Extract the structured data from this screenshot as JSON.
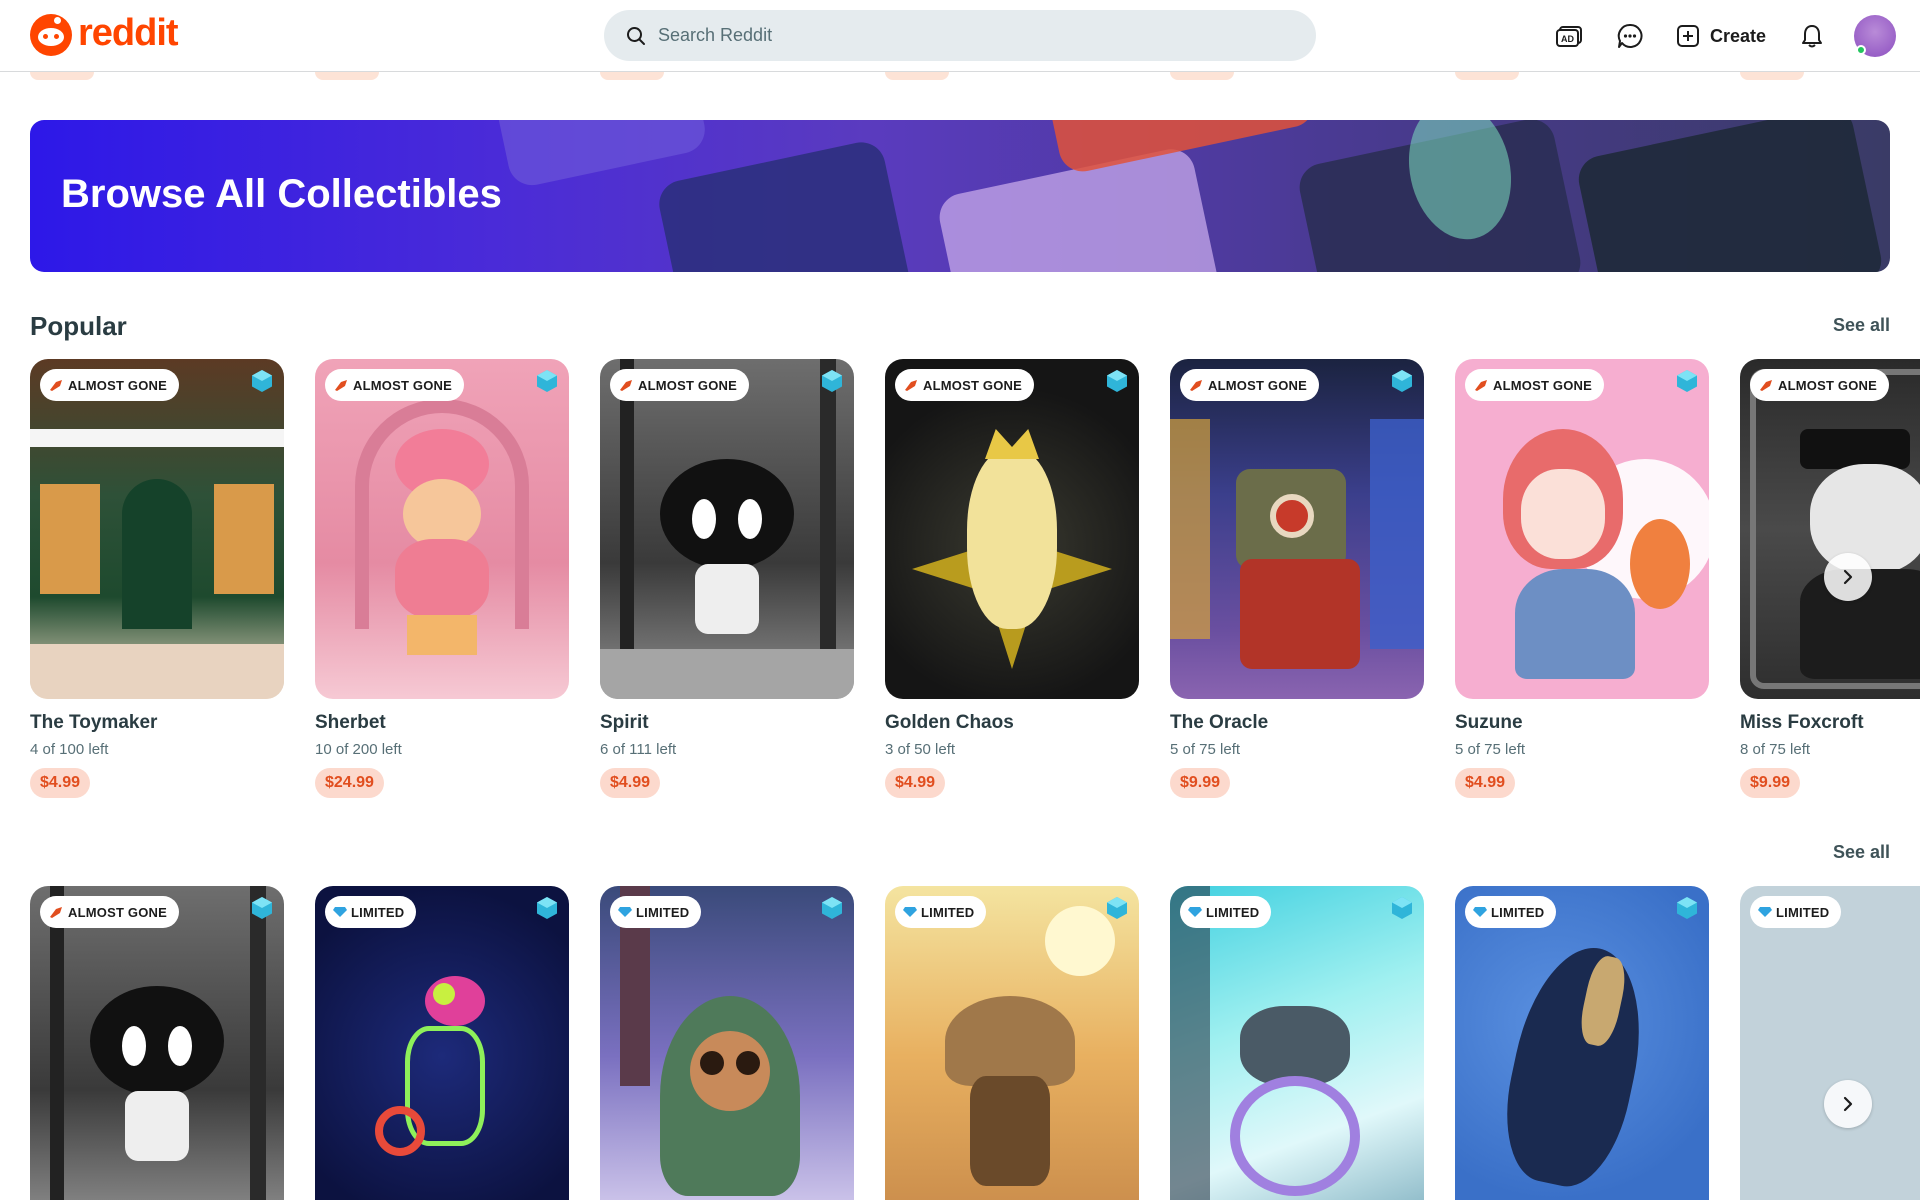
{
  "header": {
    "logo_text": "reddit",
    "search_placeholder": "Search Reddit",
    "create_label": "Create",
    "icons": [
      "advertise-icon",
      "chat-icon",
      "create-plus-icon",
      "notifications-bell-icon",
      "user-avatar"
    ]
  },
  "banner": {
    "title": "Browse All Collectibles"
  },
  "popular": {
    "title": "Popular",
    "see_all": "See all",
    "items": [
      {
        "badge": "ALMOST GONE",
        "name": "The Toymaker",
        "left": "4 of 100 left",
        "price": "$4.99"
      },
      {
        "badge": "ALMOST GONE",
        "name": "Sherbet",
        "left": "10 of 200 left",
        "price": "$24.99"
      },
      {
        "badge": "ALMOST GONE",
        "name": "Spirit",
        "left": "6 of 111 left",
        "price": "$4.99"
      },
      {
        "badge": "ALMOST GONE",
        "name": "Golden Chaos",
        "left": "3 of 50 left",
        "price": "$4.99"
      },
      {
        "badge": "ALMOST GONE",
        "name": "The Oracle",
        "left": "5 of 75 left",
        "price": "$9.99"
      },
      {
        "badge": "ALMOST GONE",
        "name": "Suzune",
        "left": "5 of 75 left",
        "price": "$4.99"
      },
      {
        "badge": "ALMOST GONE",
        "name": "Miss Foxcroft",
        "left": "8 of 75 left",
        "price": "$9.99"
      }
    ]
  },
  "second_row": {
    "see_all": "See all",
    "items": [
      {
        "badge": "ALMOST GONE"
      },
      {
        "badge": "LIMITED"
      },
      {
        "badge": "LIMITED"
      },
      {
        "badge": "LIMITED"
      },
      {
        "badge": "LIMITED"
      },
      {
        "badge": "LIMITED"
      },
      {
        "badge": "LIMITED"
      }
    ]
  },
  "colors": {
    "brand": "#ff4500",
    "price_bg": "#fcd9cd",
    "price_text": "#e14e1f",
    "search_bg": "#e5ebee"
  }
}
